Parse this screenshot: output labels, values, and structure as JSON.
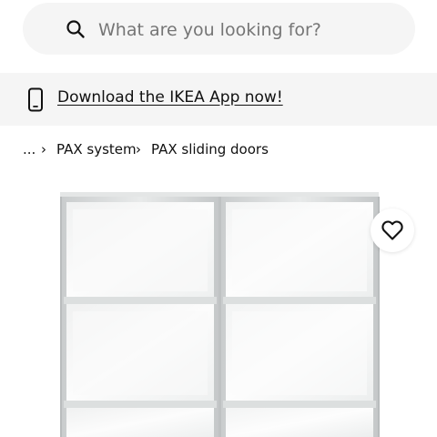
{
  "search": {
    "placeholder": "What are you looking for?"
  },
  "app_banner": {
    "link_text": "Download the IKEA App now!"
  },
  "breadcrumb": {
    "items": [
      "...",
      "PAX system",
      "PAX sliding doors"
    ],
    "separator": "›"
  },
  "product": {
    "image_icon": "wardrobe-sliding-doors",
    "favourite_icon": "heart-outline-icon"
  },
  "colors": {
    "search_bg": "#f5f5f5",
    "banner_bg": "#f5f5f5",
    "text": "#111111",
    "frame": "#d9dbdc"
  }
}
